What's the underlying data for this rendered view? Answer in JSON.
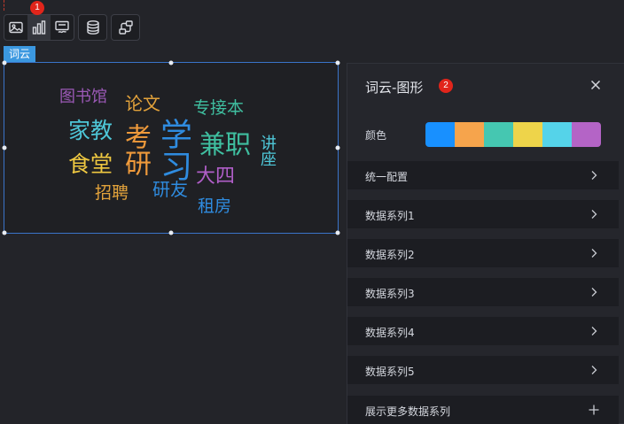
{
  "toolbar": {
    "buttons": [
      {
        "name": "image-icon"
      },
      {
        "name": "bar-chart-icon"
      },
      {
        "name": "text-icon"
      },
      {
        "name": "database-icon"
      },
      {
        "name": "flow-icon"
      }
    ],
    "badge": "1"
  },
  "component": {
    "tag": "词云",
    "words": [
      {
        "text": "图书馆",
        "color": "#9b59b6"
      },
      {
        "text": "论文",
        "color": "#e2a23b"
      },
      {
        "text": "专接本",
        "color": "#3fbfa0"
      },
      {
        "text": "家教",
        "color": "#4ec7d8"
      },
      {
        "text": "考研",
        "color": "#ef9a3b"
      },
      {
        "text": "兼职",
        "color": "#3fbfa0"
      },
      {
        "text": "讲座",
        "color": "#4ec7d8"
      },
      {
        "text": "食堂",
        "color": "#f0c941"
      },
      {
        "text": "大四",
        "color": "#b05ec8"
      },
      {
        "text": "招聘",
        "color": "#e2a23b"
      },
      {
        "text": "研友",
        "color": "#2f8ce0"
      },
      {
        "text": "租房",
        "color": "#2f8ce0"
      },
      {
        "text": "学习",
        "color": "#2f8ce0"
      }
    ]
  },
  "panel": {
    "title": "词云-图形",
    "badge": "2",
    "color_label": "颜色",
    "palette": [
      "#1890ff",
      "#f6a44c",
      "#45c7b1",
      "#eed44a",
      "#55d3e9",
      "#b464c6"
    ],
    "rows": [
      {
        "label": "统一配置"
      },
      {
        "label": "数据系列1"
      },
      {
        "label": "数据系列2"
      },
      {
        "label": "数据系列3"
      },
      {
        "label": "数据系列4"
      },
      {
        "label": "数据系列5"
      }
    ],
    "more_label": "展示更多数据系列"
  }
}
